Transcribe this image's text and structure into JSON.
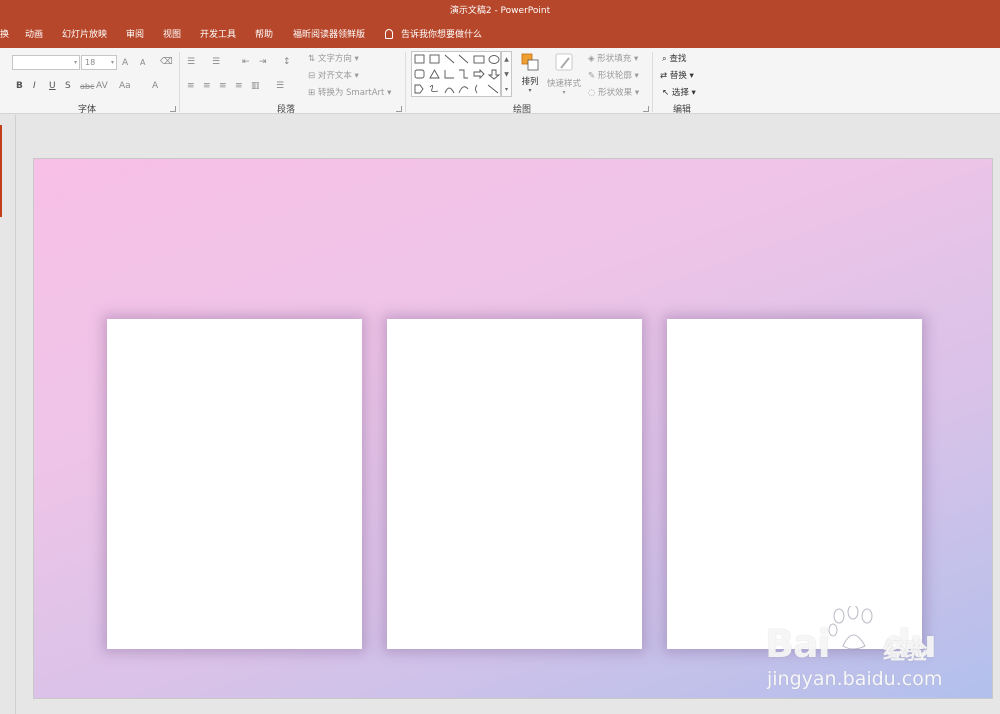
{
  "window": {
    "title": "演示文稿2  -  PowerPoint"
  },
  "tabs": [
    {
      "label": "换"
    },
    {
      "label": "动画"
    },
    {
      "label": "幻灯片放映"
    },
    {
      "label": "审阅"
    },
    {
      "label": "视图"
    },
    {
      "label": "开发工具"
    },
    {
      "label": "帮助"
    },
    {
      "label": "福昕阅读器领鲜版"
    }
  ],
  "tellme": {
    "label": "告诉我你想要做什么"
  },
  "ribbon": {
    "font_group": {
      "label": "字体",
      "font_name": "",
      "font_size": "18",
      "bold": "B",
      "italic": "I",
      "underline": "U",
      "shadow": "S",
      "strike": "abc",
      "spacing": "AV",
      "case": "Aa",
      "color": "A",
      "grow": "A",
      "shrink": "A"
    },
    "paragraph_group": {
      "label": "段落",
      "text_direction": "文字方向",
      "align_text": "对齐文本",
      "smartart": "转换为 SmartArt"
    },
    "drawing_group": {
      "label": "绘图",
      "arrange": "排列",
      "quick_styles": "快速样式",
      "shape_fill": "形状填充",
      "shape_outline": "形状轮廓",
      "shape_effects": "形状效果"
    },
    "editing_group": {
      "label": "编辑",
      "find": "查找",
      "replace": "替换",
      "select": "选择"
    }
  },
  "slide": {
    "card_count": 3
  },
  "watermark": {
    "logo": "Bai",
    "logo2": "du",
    "cn": "经验",
    "url": "jingyan.baidu.com"
  },
  "colors": {
    "accent": "#b7472a",
    "gradient_start": "#f8c0e6",
    "gradient_end": "#b2c0ec"
  }
}
